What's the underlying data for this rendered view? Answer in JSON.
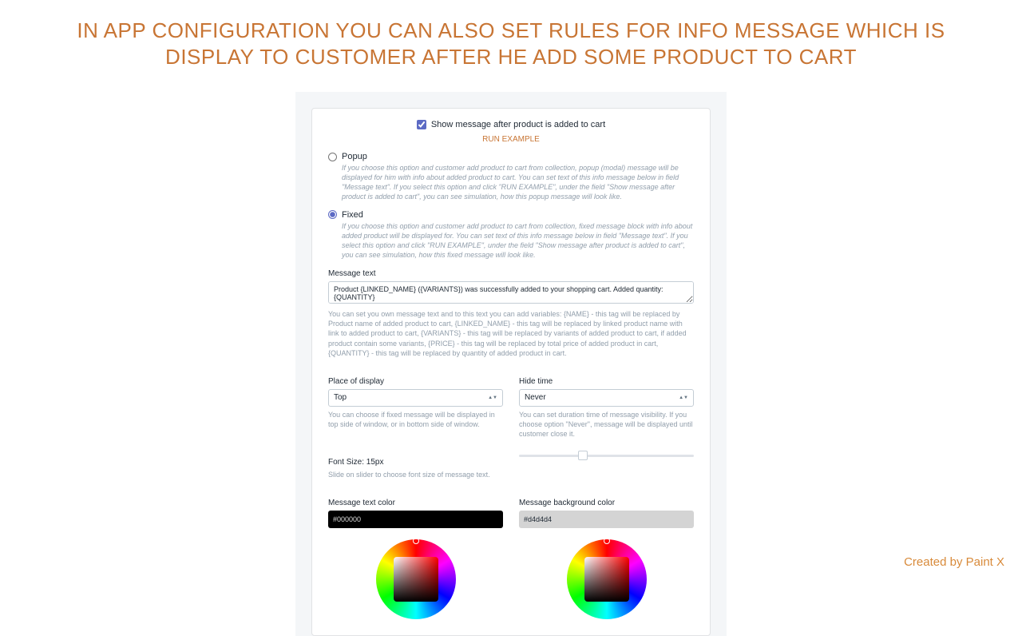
{
  "headline": "IN APP CONFIGURATION YOU CAN ALSO SET RULES FOR INFO MESSAGE WHICH IS DISPLAY TO CUSTOMER AFTER HE ADD SOME PRODUCT TO CART",
  "show_message": {
    "label": "Show message after product is added to cart",
    "checked": true
  },
  "run_example": "RUN EXAMPLE",
  "popup": {
    "label": "Popup",
    "selected": false,
    "desc": "If you choose this option and customer add product to cart from collection, popup (modal) message will be displayed for him with info about added product to cart. You can set text of this info message below in field \"Message text\". If you select this option and click \"RUN EXAMPLE\", under the field \"Show message after product is added to cart\", you can see simulation, how this popup message will look like."
  },
  "fixed": {
    "label": "Fixed",
    "selected": true,
    "desc": "If you choose this option and customer add product to cart from collection, fixed message block with info about added product will be displayed for. You can set text of this info message below in field \"Message text\". If you select this option and click \"RUN EXAMPLE\", under the field \"Show message after product is added to cart\", you can see simulation, how this fixed message will look like."
  },
  "message_text": {
    "label": "Message text",
    "value": "Product {LINKED_NAME} ({VARIANTS}) was successfully added to your shopping cart. Added quantity: {QUANTITY}",
    "help": "You can set you own message text and to this text you can add variables: {NAME} - this tag will be replaced by Product name of added product to cart, {LINKED_NAME} - this tag will be replaced by linked product name with link to added product to cart, {VARIANTS} - this tag will be replaced by variants of added product to cart, if added product contain some variants, {PRICE} - this tag will be replaced by total price of added product in cart, {QUANTITY} - this tag will be replaced by quantity of added product in cart."
  },
  "place": {
    "label": "Place of display",
    "value": "Top",
    "help": "You can choose if fixed message will be displayed in top side of window, or in bottom side of window."
  },
  "hide": {
    "label": "Hide time",
    "value": "Never",
    "help": "You can set duration time of message visibility. If you choose option \"Never\", message will be displayed until customer close it."
  },
  "font": {
    "label": "Font Size: 15px",
    "help": "Slide on slider to choose font size of message text."
  },
  "text_color": {
    "label": "Message text color",
    "value": "#000000"
  },
  "bg_color": {
    "label": "Message background color",
    "value": "#d4d4d4"
  },
  "footer": "Created by Paint X"
}
